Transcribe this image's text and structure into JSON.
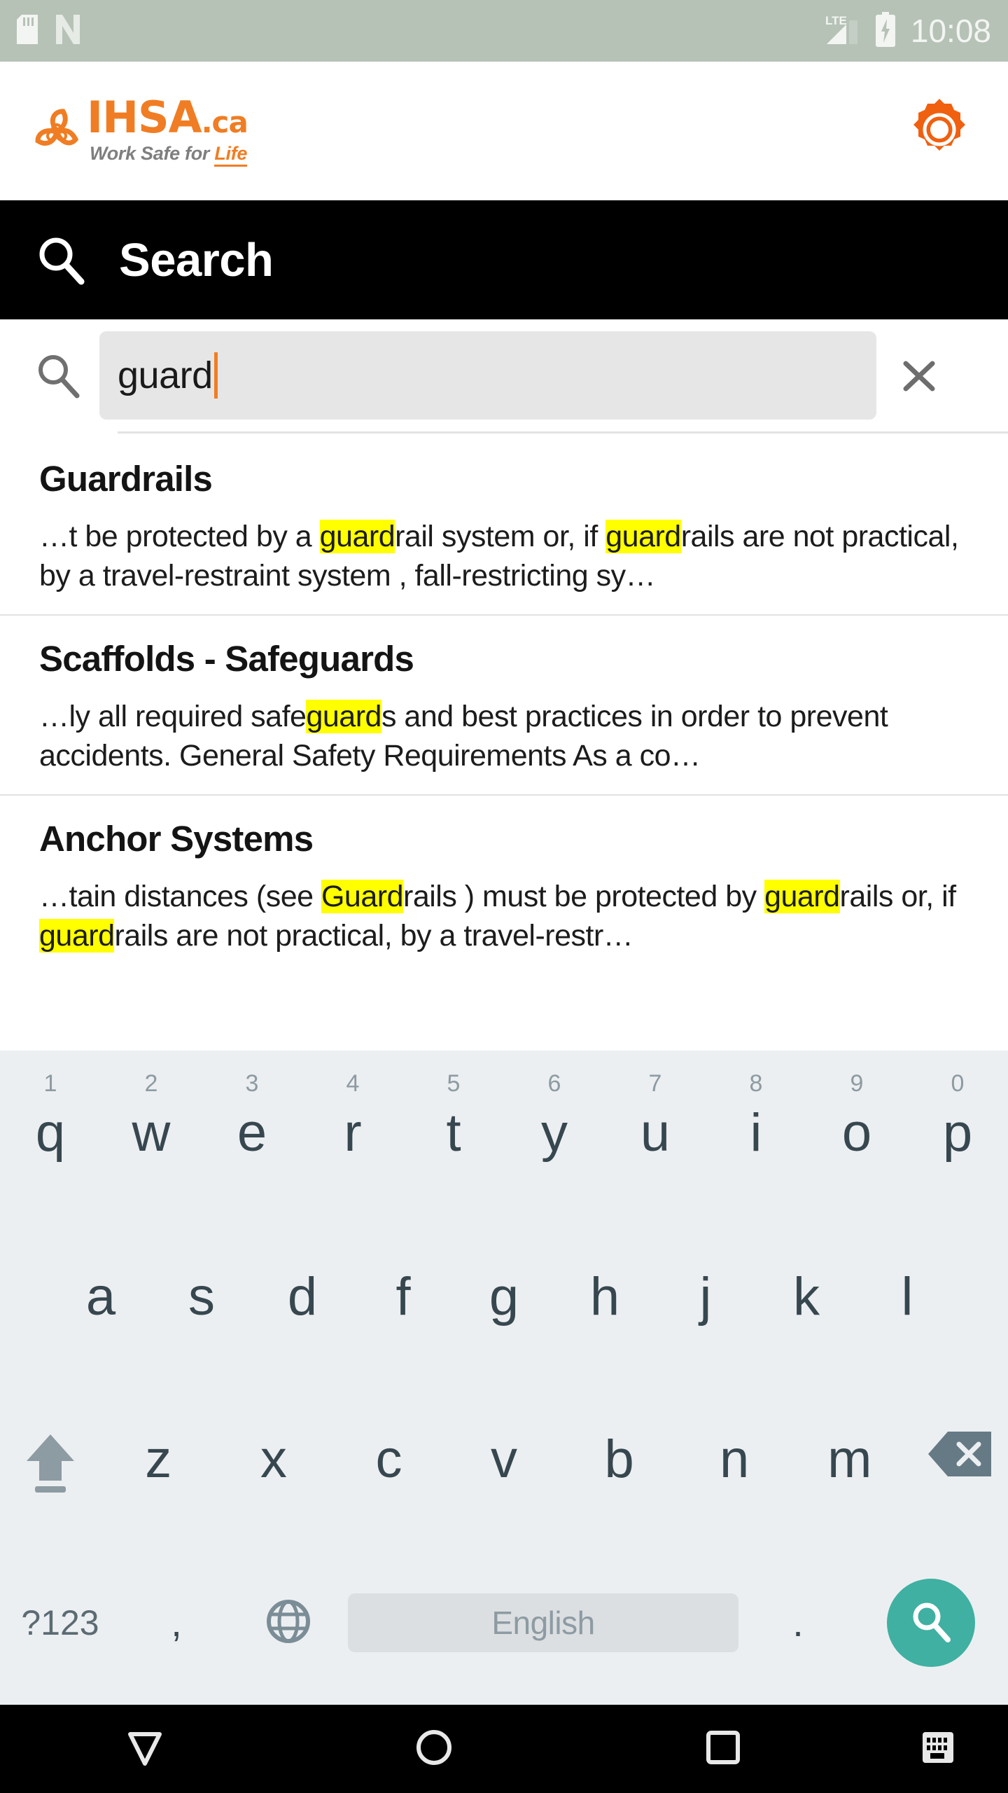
{
  "statusbar": {
    "time": "10:08",
    "network_label": "LTE",
    "icons": [
      "sd-card-icon",
      "nfc-n-icon",
      "lte-signal-icon",
      "battery-charging-icon"
    ]
  },
  "appheader": {
    "logo_name": "IHSA",
    "logo_suffix": ".ca",
    "tagline_prefix": "Work Safe for ",
    "tagline_accent": "Life",
    "settings_icon": "gear-icon",
    "brand_color": "#f07d23"
  },
  "titlebar": {
    "title": "Search",
    "icon": "search-icon"
  },
  "search": {
    "value": "guard",
    "placeholder": "Search",
    "left_icon": "search-icon",
    "clear_icon": "close-icon",
    "caret_color": "#f07d23"
  },
  "results": [
    {
      "title": "Guardrails",
      "snippet_parts": [
        {
          "text": "…t be protected by a ",
          "hl": false
        },
        {
          "text": "guard",
          "hl": true
        },
        {
          "text": "rail system or, if ",
          "hl": false
        },
        {
          "text": "guard",
          "hl": true
        },
        {
          "text": "rails are not practical, by a travel-restraint system , fall-restricting sy…",
          "hl": false
        }
      ]
    },
    {
      "title": "Scaffolds - Safeguards",
      "snippet_parts": [
        {
          "text": "…ly all required safe",
          "hl": false
        },
        {
          "text": "guard",
          "hl": true
        },
        {
          "text": "s and best practices in order to prevent accidents. General Safety Requirements As a co…",
          "hl": false
        }
      ]
    },
    {
      "title": "Anchor Systems",
      "snippet_parts": [
        {
          "text": "…tain distances (see ",
          "hl": false
        },
        {
          "text": "Guard",
          "hl": true
        },
        {
          "text": "rails ) must be protected by ",
          "hl": false
        },
        {
          "text": "guard",
          "hl": true
        },
        {
          "text": "rails or, if ",
          "hl": false
        },
        {
          "text": "guard",
          "hl": true
        },
        {
          "text": "rails are not practical, by a travel-restr…",
          "hl": false
        }
      ]
    }
  ],
  "keyboard": {
    "row1": [
      {
        "letter": "q",
        "num": "1"
      },
      {
        "letter": "w",
        "num": "2"
      },
      {
        "letter": "e",
        "num": "3"
      },
      {
        "letter": "r",
        "num": "4"
      },
      {
        "letter": "t",
        "num": "5"
      },
      {
        "letter": "y",
        "num": "6"
      },
      {
        "letter": "u",
        "num": "7"
      },
      {
        "letter": "i",
        "num": "8"
      },
      {
        "letter": "o",
        "num": "9"
      },
      {
        "letter": "p",
        "num": "0"
      }
    ],
    "row2": [
      "a",
      "s",
      "d",
      "f",
      "g",
      "h",
      "j",
      "k",
      "l"
    ],
    "row3": [
      "z",
      "x",
      "c",
      "v",
      "b",
      "n",
      "m"
    ],
    "shift_icon": "shift-icon",
    "delete_icon": "backspace-icon",
    "symbols_label": "?123",
    "comma_label": ",",
    "globe_icon": "language-globe-icon",
    "space_label": "English",
    "period_label": ".",
    "enter_icon": "search-icon",
    "enter_color": "#3fb0a2"
  },
  "navbar": {
    "back_icon": "hide-keyboard-down-icon",
    "home_icon": "home-circle-icon",
    "recents_icon": "recents-square-icon",
    "keyboard_icon": "keyboard-switcher-icon"
  }
}
